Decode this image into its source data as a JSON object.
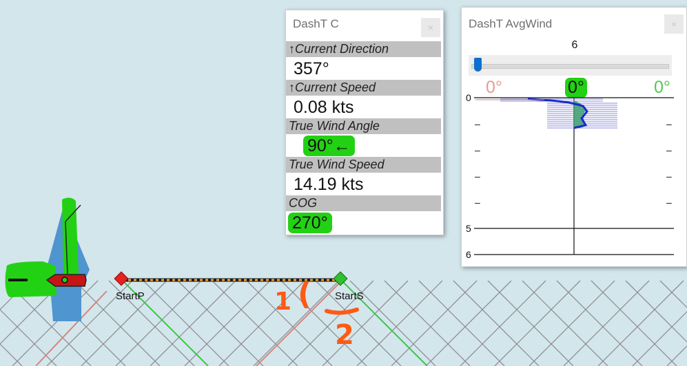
{
  "map": {
    "start_port_label": "StartP",
    "start_starboard_label": "StartS",
    "annotations": {
      "one": "1",
      "open_paren": "(",
      "two": "2"
    },
    "colors": {
      "sea": "#d3e6ec",
      "grid": "#8f8f94",
      "laylines_green": "#3fc34a",
      "laylines_red": "#d1877f",
      "port_mark": "#e82020",
      "starboard_mark": "#30c030",
      "boat_hull": "#c41616",
      "sail": "#4f95cf",
      "annotation": "#ff5a14",
      "highlight": "#23d114"
    }
  },
  "dash_c": {
    "title": "DashT C",
    "close_label": "×",
    "rows": [
      {
        "label": "↑Current Direction",
        "value": "357°",
        "highlight": false
      },
      {
        "label": "↑Current Speed",
        "value": "0.08 kts",
        "highlight": false
      },
      {
        "label": "True Wind Angle",
        "value": "90°←",
        "highlight": true
      },
      {
        "label": "True Wind Speed",
        "value": "14.19 kts",
        "highlight": false
      },
      {
        "label": "COG",
        "value": "270°",
        "highlight": true
      }
    ]
  },
  "dash_avg": {
    "title": "DashT AvgWind",
    "close_label": "×",
    "slider_value": "6",
    "slider_fraction": 0.0,
    "port_label": "0°",
    "center_label": "0°",
    "starboard_label": "0°",
    "tick_top": "0",
    "tick_mid": "5",
    "tick_bottom": "6",
    "minor_tick": "–"
  }
}
